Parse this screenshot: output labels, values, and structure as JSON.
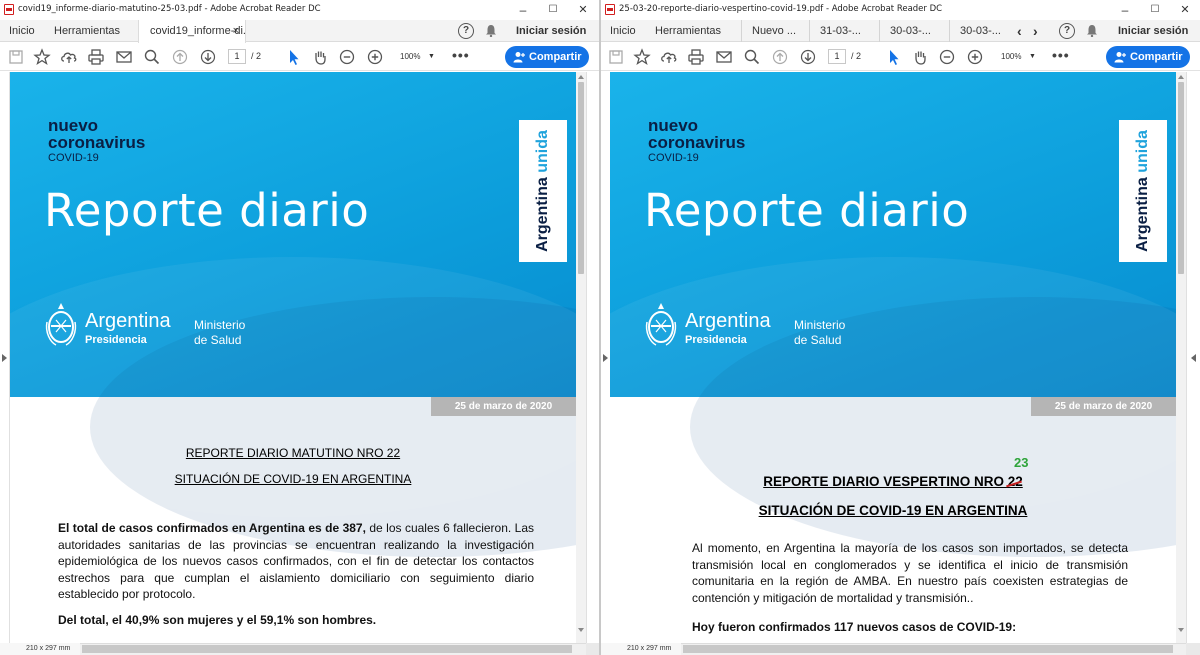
{
  "left_window": {
    "title": "covid19_informe-diario-matutino-25-03.pdf - Adobe Acrobat Reader DC",
    "menu": {
      "home": "Inicio",
      "tools": "Herramientas",
      "doc_tab": "covid19_informe-di...",
      "doc_tab_close": "×",
      "sign_in": "Iniciar sesión"
    },
    "toolbar": {
      "page_current": "1",
      "page_total": "/ 2",
      "zoom": "100%",
      "more": "•••",
      "share_label": "Compartir"
    },
    "page_dims": "210 x 297 mm",
    "doc": {
      "brand_line1": "nuevo",
      "brand_line2": "coronavirus",
      "brand_line3": "COVID-19",
      "headline": "Reporte diario",
      "badge_a": "Argentina",
      "badge_b": "unida",
      "gov_name": "Argentina",
      "gov_sub": "Presidencia",
      "ministry_1": "Ministerio",
      "ministry_2": "de Salud",
      "date": "25 de marzo de 2020",
      "title1": "REPORTE DIARIO MATUTINO NRO 22",
      "title2": "SITUACIÓN DE COVID-19 EN ARGENTINA",
      "para1_bold": "El total de casos confirmados en Argentina es de 387,",
      "para1_rest": " de los cuales 6 fallecieron. Las autoridades sanitarias de las provincias se encuentran realizando la investigación epidemiológica de los nuevos casos confirmados, con el fin de detectar los contactos estrechos para que cumplan el aislamiento domiciliario con seguimiento diario establecido por protocolo.",
      "para2": "Del total, el 40,9% son mujeres y el 59,1% son hombres."
    }
  },
  "right_window": {
    "title": "25-03-20-reporte-diario-vespertino-covid-19.pdf - Adobe Acrobat Reader DC",
    "menu": {
      "home": "Inicio",
      "tools": "Herramientas",
      "tabs": [
        "Nuevo ...",
        "31-03-...",
        "30-03-...",
        "30-03-..."
      ],
      "prev": "‹",
      "next": "›",
      "sign_in": "Iniciar sesión"
    },
    "toolbar": {
      "page_current": "1",
      "page_total": "/ 2",
      "zoom": "100%",
      "more": "•••",
      "share_label": "Compartir"
    },
    "page_dims": "210 x 297 mm",
    "doc": {
      "brand_line1": "nuevo",
      "brand_line2": "coronavirus",
      "brand_line3": "COVID-19",
      "headline": "Reporte diario",
      "badge_a": "Argentina",
      "badge_b": "unida",
      "gov_name": "Argentina",
      "gov_sub": "Presidencia",
      "ministry_1": "Ministerio",
      "ministry_2": "de Salud",
      "date": "25 de marzo de 2020",
      "annotation": "23",
      "title1": "REPORTE DIARIO VESPERTINO NRO 22",
      "title2": "SITUACIÓN DE COVID-19 EN ARGENTINA",
      "para1": "Al momento, en Argentina la mayoría de los casos son importados, se detecta transmisión local en conglomerados y se identifica el inicio de transmisión comunitaria en la región de AMBA. En nuestro país coexisten estrategias de contención y mitigación de mortalidad y transmisión..",
      "para2": "Hoy fueron confirmados 117 nuevos casos de COVID-19:"
    }
  },
  "window_controls": {
    "minimize": "–",
    "maximize": "☐",
    "close": "✕"
  },
  "colors": {
    "banner": "#0d9fdc",
    "share_button": "#1473e6",
    "annotation_green": "#2ea43a",
    "annotation_red": "#c82020",
    "navy": "#0a1f44"
  }
}
